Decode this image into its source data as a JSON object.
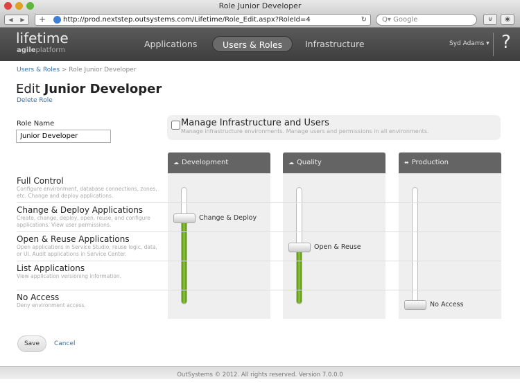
{
  "browser": {
    "window_title": "Role Junior Developer",
    "url": "http://prod.nextstep.outsystems.com/Lifetime/Role_Edit.aspx?RoleId=4",
    "search_placeholder": "Google"
  },
  "header": {
    "logo": "lifetime",
    "logo_sub_bold": "agile",
    "logo_sub": "platform",
    "nav": [
      {
        "label": "Applications"
      },
      {
        "label": "Users & Roles"
      },
      {
        "label": "Infrastructure"
      }
    ],
    "user": "Syd Adams ▾",
    "help": "?"
  },
  "breadcrumb": {
    "parent": "Users & Roles",
    "sep": " > ",
    "current": "Role Junior Developer"
  },
  "page": {
    "title_prefix": "Edit ",
    "title_name": "Junior Developer",
    "delete": "Delete Role",
    "role_name_label": "Role Name",
    "role_name_value": "Junior Developer"
  },
  "manage": {
    "title": "Manage Infrastructure and Users",
    "desc": "Manage infrastructure environments. Manage users and permissions in all environments.",
    "checked": false
  },
  "levels": [
    {
      "name": "Full Control",
      "desc": "Configure environment, database connections, zones, etc. Change and deploy applications."
    },
    {
      "name": "Change & Deploy Applications",
      "desc": "Create, change, deploy, open, reuse, and configure applications. View user permissions."
    },
    {
      "name": "Open & Reuse Applications",
      "desc": "Open applications in Service Studio, reuse logic, data, or UI. Audit applications in Service Center."
    },
    {
      "name": "List Applications",
      "desc": "View application versioning information."
    },
    {
      "name": "No Access",
      "desc": "Deny environment access."
    }
  ],
  "environments": [
    {
      "name": "Development",
      "level_index": 1,
      "value_label": "Change & Deploy"
    },
    {
      "name": "Quality",
      "level_index": 2,
      "value_label": "Open & Reuse"
    },
    {
      "name": "Production",
      "level_index": 4,
      "value_label": "No Access"
    }
  ],
  "actions": {
    "save": "Save",
    "cancel": "Cancel"
  },
  "footer": "OutSystems © 2012. All rights reserved.    Version 7.0.0.0"
}
